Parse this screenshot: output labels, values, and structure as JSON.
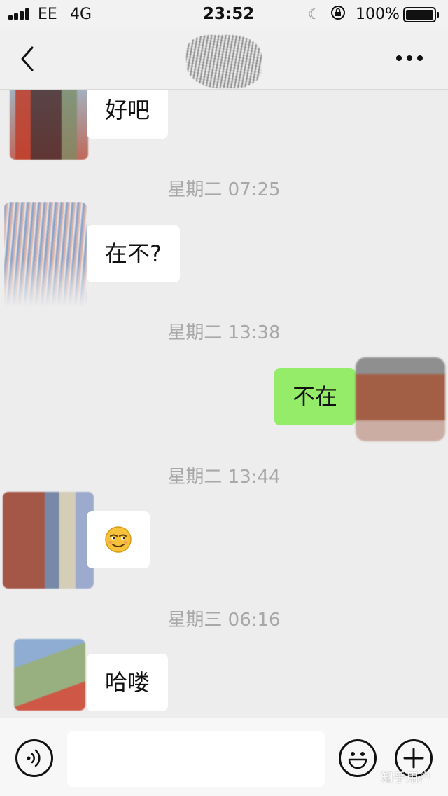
{
  "status_bar": {
    "carrier": "EE",
    "network": "4G",
    "time": "23:52",
    "battery_percent": "100%"
  },
  "nav": {
    "back_icon": "chevron-left-icon",
    "more_icon": "ellipsis-icon"
  },
  "messages": [
    {
      "kind": "in",
      "text": "好吧"
    },
    {
      "kind": "time",
      "text": "星期二 07:25"
    },
    {
      "kind": "in",
      "text": "在不?"
    },
    {
      "kind": "time",
      "text": "星期二 13:38"
    },
    {
      "kind": "out",
      "text": "不在"
    },
    {
      "kind": "time",
      "text": "星期二 13:44"
    },
    {
      "kind": "in",
      "text": "",
      "emoji": "smirk-emoji"
    },
    {
      "kind": "time",
      "text": "星期三 06:16"
    },
    {
      "kind": "in",
      "text": "哈喽"
    }
  ],
  "input_bar": {
    "voice_icon": "voice-icon",
    "input_value": "",
    "emoji_icon": "smiley-icon",
    "plus_icon": "plus-icon"
  },
  "watermark": "知乎用户",
  "colors": {
    "chat_background": "#ededed",
    "outgoing_bubble": "#95ec69",
    "incoming_bubble": "#ffffff",
    "timestamp_text": "#a8a8a8"
  }
}
